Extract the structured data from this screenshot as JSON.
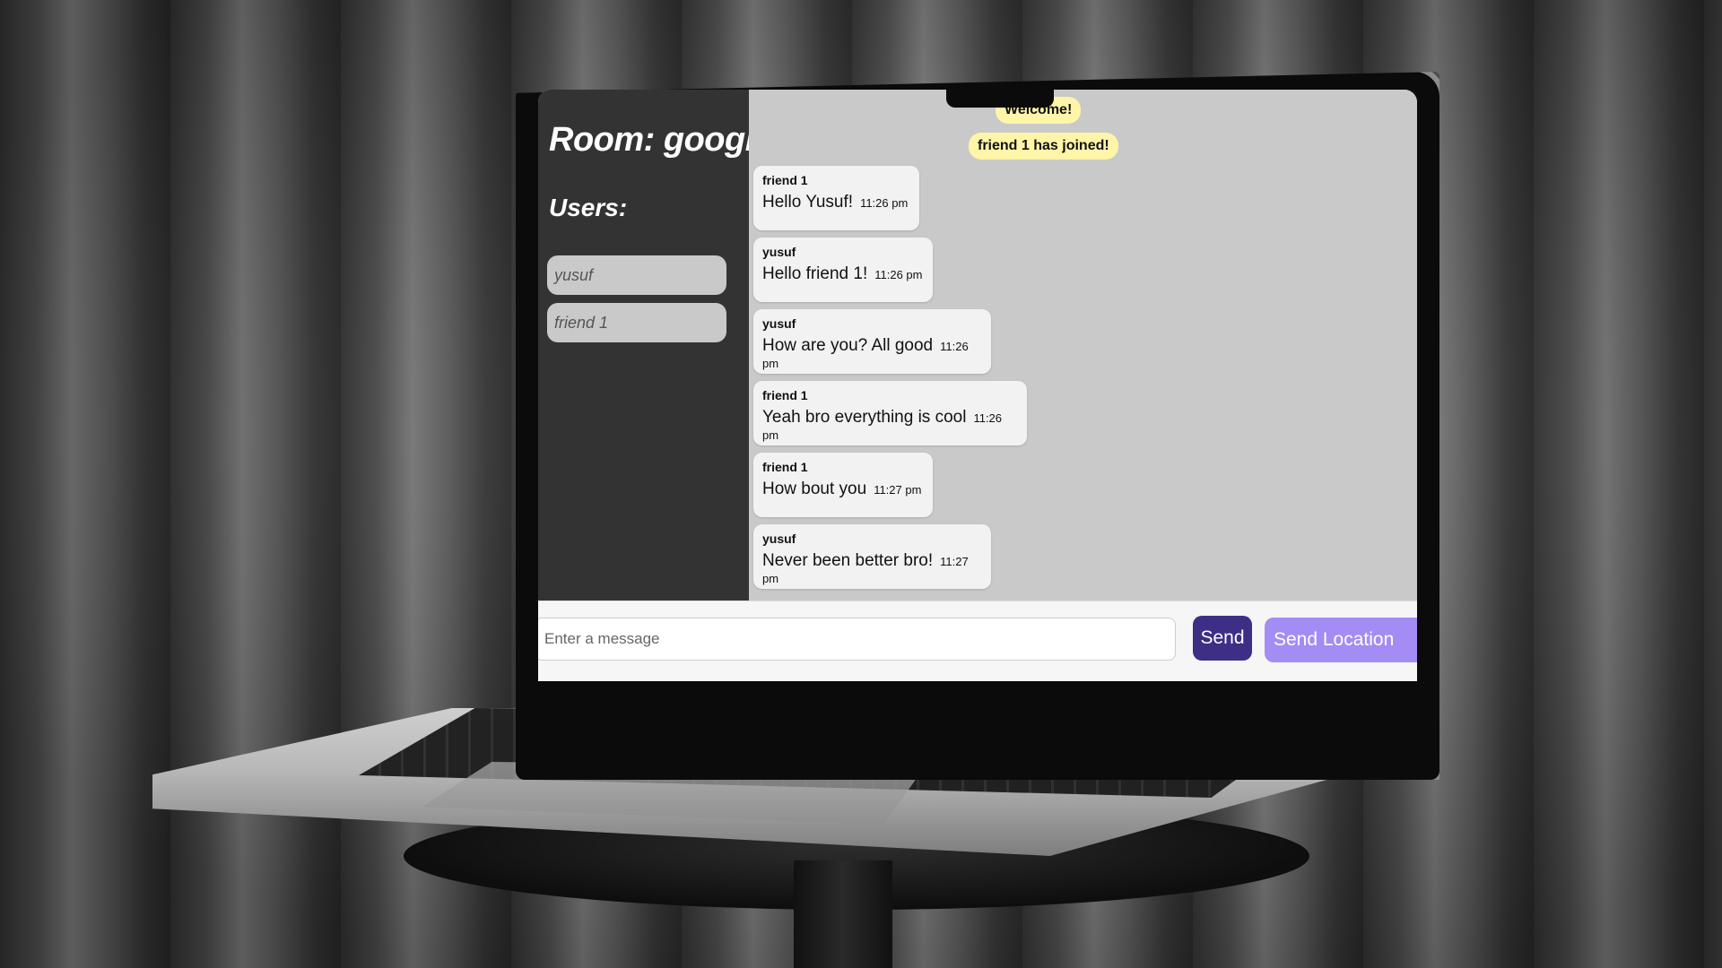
{
  "room": {
    "title": "Room: google",
    "users_heading": "Users:"
  },
  "users": [
    {
      "name": "yusuf"
    },
    {
      "name": "friend 1"
    }
  ],
  "system_messages": [
    {
      "text": "Welcome!"
    },
    {
      "text": "friend 1 has joined!"
    }
  ],
  "messages": [
    {
      "author": "friend 1",
      "text": "Hello Yusuf!",
      "time": "11:26 pm"
    },
    {
      "author": "yusuf",
      "text": "Hello friend 1!",
      "time": "11:26 pm"
    },
    {
      "author": "yusuf",
      "text": "How are you? All good",
      "time": "11:26 pm"
    },
    {
      "author": "friend 1",
      "text": "Yeah bro everything is cool",
      "time": "11:26 pm"
    },
    {
      "author": "friend 1",
      "text": "How bout you",
      "time": "11:27 pm"
    },
    {
      "author": "yusuf",
      "text": "Never been better bro!",
      "time": "11:27 pm"
    }
  ],
  "composer": {
    "placeholder": "Enter a message",
    "send_label": "Send",
    "location_label": "Send Location"
  },
  "colors": {
    "sidebar_bg": "#333333",
    "chat_bg": "#c9c9c9",
    "system_msg_bg": "#fff5a8",
    "send_button": "#3f2e86",
    "location_button": "#a48cf5"
  }
}
